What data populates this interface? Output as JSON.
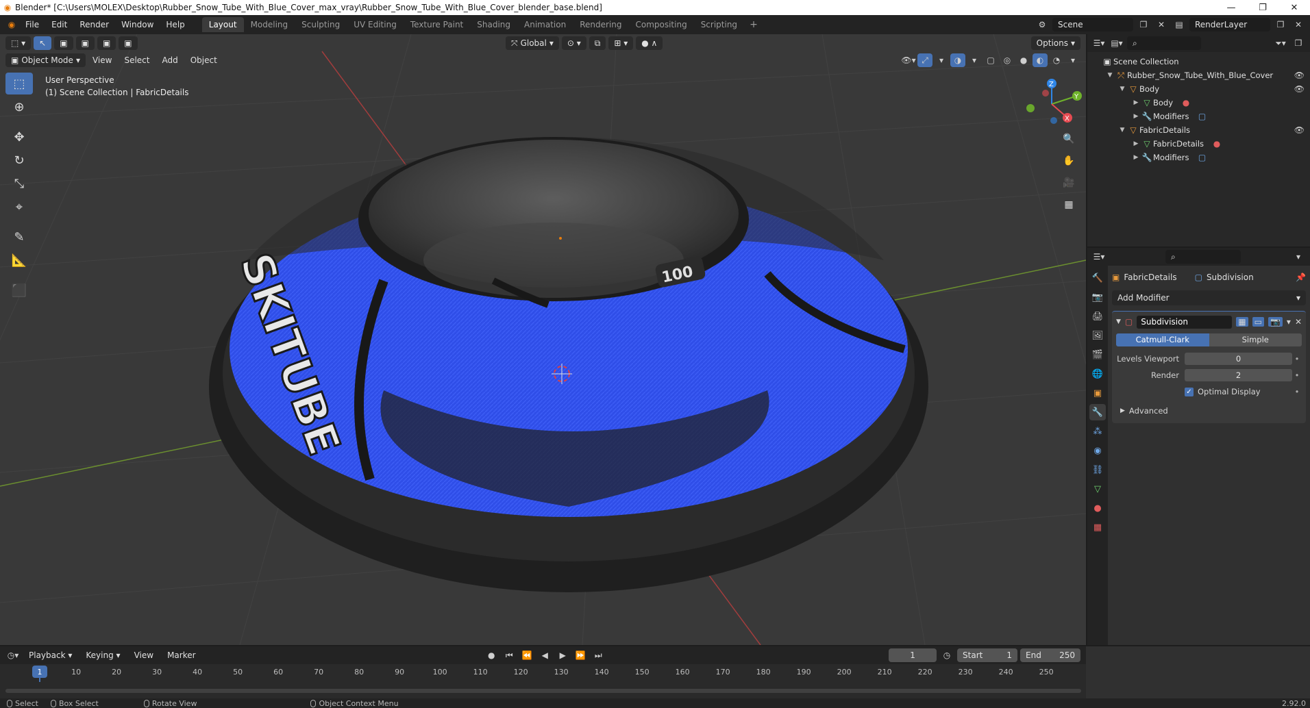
{
  "titlebar": {
    "title": "Blender* [C:\\Users\\MOLEX\\Desktop\\Rubber_Snow_Tube_With_Blue_Cover_max_vray\\Rubber_Snow_Tube_With_Blue_Cover_blender_base.blend]"
  },
  "menu": [
    "File",
    "Edit",
    "Render",
    "Window",
    "Help"
  ],
  "workspaces": [
    "Layout",
    "Modeling",
    "Sculpting",
    "UV Editing",
    "Texture Paint",
    "Shading",
    "Animation",
    "Rendering",
    "Compositing",
    "Scripting"
  ],
  "workspace_active": "Layout",
  "scene": {
    "scene_name": "Scene",
    "render_layer": "RenderLayer"
  },
  "viewport": {
    "mode": "Object Mode",
    "menus": [
      "View",
      "Select",
      "Add",
      "Object"
    ],
    "transform_orientation": "Global",
    "options_label": "Options",
    "info_line1": "User Perspective",
    "info_line2": "(1) Scene Collection | FabricDetails",
    "axis_labels": {
      "x": "X",
      "y": "Y",
      "z": "Z"
    },
    "model_text": {
      "brand": "SKITUBE",
      "badge": "100"
    }
  },
  "outliner": {
    "root": "Scene Collection",
    "rows": [
      {
        "label": "Rubber_Snow_Tube_With_Blue_Cover",
        "depth": 1
      },
      {
        "label": "Body",
        "depth": 2
      },
      {
        "label": "Body",
        "depth": 3
      },
      {
        "label": "Modifiers",
        "depth": 3
      },
      {
        "label": "FabricDetails",
        "depth": 2
      },
      {
        "label": "FabricDetails",
        "depth": 3
      },
      {
        "label": "Modifiers",
        "depth": 3
      }
    ]
  },
  "properties": {
    "object_name": "FabricDetails",
    "modifier_crumb": "Subdivision",
    "add_modifier": "Add Modifier",
    "modifier": {
      "name": "Subdivision",
      "type_a": "Catmull-Clark",
      "type_b": "Simple",
      "levels_viewport_label": "Levels Viewport",
      "levels_viewport_value": "0",
      "render_label": "Render",
      "render_value": "2",
      "optimal_display_label": "Optimal Display",
      "advanced_label": "Advanced"
    }
  },
  "timeline": {
    "menus": [
      "Playback",
      "Keying",
      "View",
      "Marker"
    ],
    "current_frame": "1",
    "start_label": "Start",
    "start_value": "1",
    "end_label": "End",
    "end_value": "250",
    "ticks": [
      "1",
      "10",
      "20",
      "30",
      "40",
      "50",
      "60",
      "70",
      "80",
      "90",
      "100",
      "110",
      "120",
      "130",
      "140",
      "150",
      "160",
      "170",
      "180",
      "190",
      "200",
      "210",
      "220",
      "230",
      "240",
      "250"
    ]
  },
  "statusbar": {
    "select": "Select",
    "box_select": "Box Select",
    "rotate_view": "Rotate View",
    "context_menu": "Object Context Menu",
    "version": "2.92.0"
  },
  "colors": {
    "accent": "#4772b3",
    "blender_orange": "#e87d0d",
    "tube_blue": "#2f4ee8",
    "tube_dark": "#2a2a2a",
    "axis_x": "#e64b52",
    "axis_y": "#6fb32b",
    "axis_z": "#2f86e8"
  }
}
